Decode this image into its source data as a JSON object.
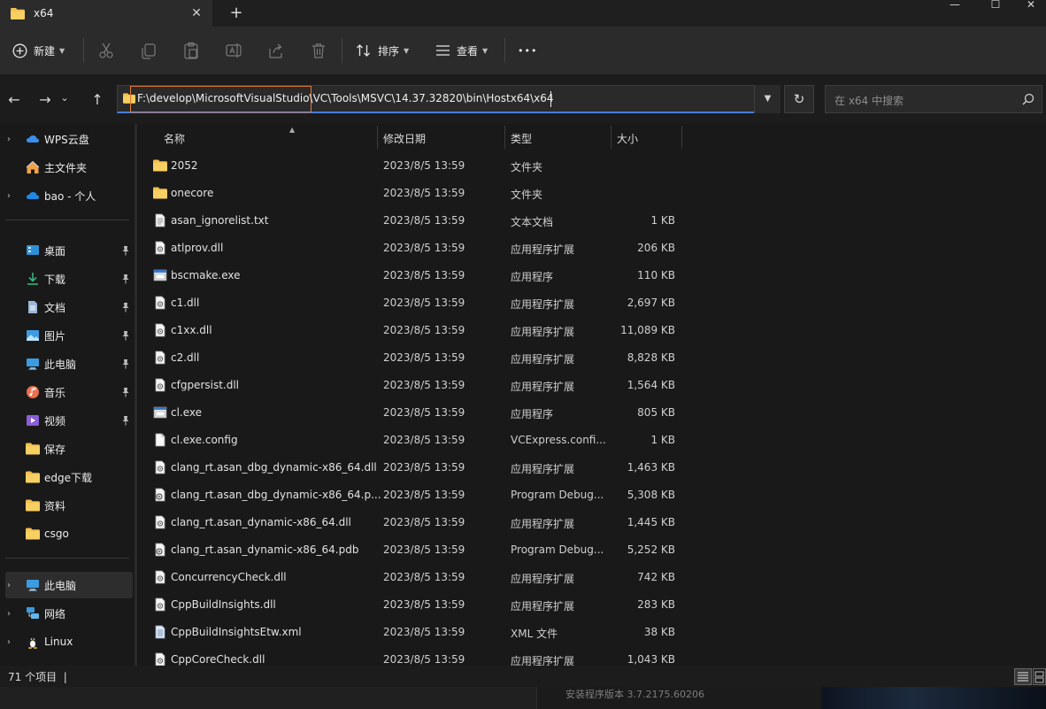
{
  "window": {
    "tab_title": "x64",
    "tab_close": "✕",
    "new_tab": "+",
    "min": "—",
    "max": "☐",
    "close": "✕"
  },
  "toolbar": {
    "new_label": "新建",
    "sort_label": "排序",
    "view_label": "查看",
    "more_label": "•••",
    "icons": [
      "cut-icon",
      "copy-icon",
      "paste-icon",
      "rename-icon",
      "share-icon",
      "delete-icon"
    ]
  },
  "nav": {
    "back": "←",
    "forward": "→",
    "recent": "⌄",
    "up": "↑",
    "address": "F:\\develop\\MicrosoftVisualStudio\\VC\\Tools\\MSVC\\14.37.32820\\bin\\Hostx64\\x64",
    "refresh": "↻",
    "search_placeholder": "在 x64 中搜索"
  },
  "sidebar": {
    "top": [
      {
        "label": "WPS云盘",
        "icon": "cloud-icon",
        "chevron": true
      },
      {
        "label": "主文件夹",
        "icon": "home-icon",
        "chevron": false
      },
      {
        "label": "bao - 个人",
        "icon": "onedrive-icon",
        "chevron": true
      }
    ],
    "quick": [
      {
        "label": "桌面",
        "icon": "desktop-icon",
        "pinned": true
      },
      {
        "label": "下载",
        "icon": "download-icon",
        "pinned": true
      },
      {
        "label": "文档",
        "icon": "documents-icon",
        "pinned": true
      },
      {
        "label": "图片",
        "icon": "pictures-icon",
        "pinned": true
      },
      {
        "label": "此电脑",
        "icon": "computer-icon",
        "pinned": true
      },
      {
        "label": "音乐",
        "icon": "music-icon",
        "pinned": true
      },
      {
        "label": "视频",
        "icon": "video-icon",
        "pinned": true
      },
      {
        "label": "保存",
        "icon": "folder-icon",
        "pinned": false
      },
      {
        "label": "edge下载",
        "icon": "folder-icon",
        "pinned": false
      },
      {
        "label": "资料",
        "icon": "folder-icon",
        "pinned": false
      },
      {
        "label": "csgo",
        "icon": "folder-icon",
        "pinned": false
      }
    ],
    "bottom": [
      {
        "label": "此电脑",
        "icon": "computer-icon",
        "active": true
      },
      {
        "label": "网络",
        "icon": "network-icon",
        "active": false
      },
      {
        "label": "Linux",
        "icon": "linux-icon",
        "active": false
      }
    ],
    "pin_glyph": "📌",
    "chevron_glyph": "›"
  },
  "columns": {
    "name": "名称",
    "date": "修改日期",
    "type": "类型",
    "size": "大小"
  },
  "files": [
    {
      "name": "2052",
      "date": "2023/8/5 13:59",
      "type": "文件夹",
      "size": "",
      "icon": "folder"
    },
    {
      "name": "onecore",
      "date": "2023/8/5 13:59",
      "type": "文件夹",
      "size": "",
      "icon": "folder"
    },
    {
      "name": "asan_ignorelist.txt",
      "date": "2023/8/5 13:59",
      "type": "文本文档",
      "size": "1 KB",
      "icon": "text"
    },
    {
      "name": "atlprov.dll",
      "date": "2023/8/5 13:59",
      "type": "应用程序扩展",
      "size": "206 KB",
      "icon": "dll"
    },
    {
      "name": "bscmake.exe",
      "date": "2023/8/5 13:59",
      "type": "应用程序",
      "size": "110 KB",
      "icon": "exe"
    },
    {
      "name": "c1.dll",
      "date": "2023/8/5 13:59",
      "type": "应用程序扩展",
      "size": "2,697 KB",
      "icon": "dll"
    },
    {
      "name": "c1xx.dll",
      "date": "2023/8/5 13:59",
      "type": "应用程序扩展",
      "size": "11,089 KB",
      "icon": "dll"
    },
    {
      "name": "c2.dll",
      "date": "2023/8/5 13:59",
      "type": "应用程序扩展",
      "size": "8,828 KB",
      "icon": "dll"
    },
    {
      "name": "cfgpersist.dll",
      "date": "2023/8/5 13:59",
      "type": "应用程序扩展",
      "size": "1,564 KB",
      "icon": "dll"
    },
    {
      "name": "cl.exe",
      "date": "2023/8/5 13:59",
      "type": "应用程序",
      "size": "805 KB",
      "icon": "exe"
    },
    {
      "name": "cl.exe.config",
      "date": "2023/8/5 13:59",
      "type": "VCExpress.confi...",
      "size": "1 KB",
      "icon": "file"
    },
    {
      "name": "clang_rt.asan_dbg_dynamic-x86_64.dll",
      "date": "2023/8/5 13:59",
      "type": "应用程序扩展",
      "size": "1,463 KB",
      "icon": "dll"
    },
    {
      "name": "clang_rt.asan_dbg_dynamic-x86_64.p...",
      "date": "2023/8/5 13:59",
      "type": "Program Debug...",
      "size": "5,308 KB",
      "icon": "pdb"
    },
    {
      "name": "clang_rt.asan_dynamic-x86_64.dll",
      "date": "2023/8/5 13:59",
      "type": "应用程序扩展",
      "size": "1,445 KB",
      "icon": "dll"
    },
    {
      "name": "clang_rt.asan_dynamic-x86_64.pdb",
      "date": "2023/8/5 13:59",
      "type": "Program Debug...",
      "size": "5,252 KB",
      "icon": "pdb"
    },
    {
      "name": "ConcurrencyCheck.dll",
      "date": "2023/8/5 13:59",
      "type": "应用程序扩展",
      "size": "742 KB",
      "icon": "dll"
    },
    {
      "name": "CppBuildInsights.dll",
      "date": "2023/8/5 13:59",
      "type": "应用程序扩展",
      "size": "283 KB",
      "icon": "dll"
    },
    {
      "name": "CppBuildInsightsEtw.xml",
      "date": "2023/8/5 13:59",
      "type": "XML 文件",
      "size": "38 KB",
      "icon": "xml"
    },
    {
      "name": "CppCoreCheck.dll",
      "date": "2023/8/5 13:59",
      "type": "应用程序扩展",
      "size": "1,043 KB",
      "icon": "dll"
    }
  ],
  "status": {
    "count": "71 个项目",
    "separator": "|"
  },
  "background": {
    "installer_version": "安装程序版本 3.7.2175.60206"
  },
  "colors": {
    "accent": "#4a7dd6",
    "folder": "#f4c04e",
    "highlight_border": "#e07a2e"
  }
}
